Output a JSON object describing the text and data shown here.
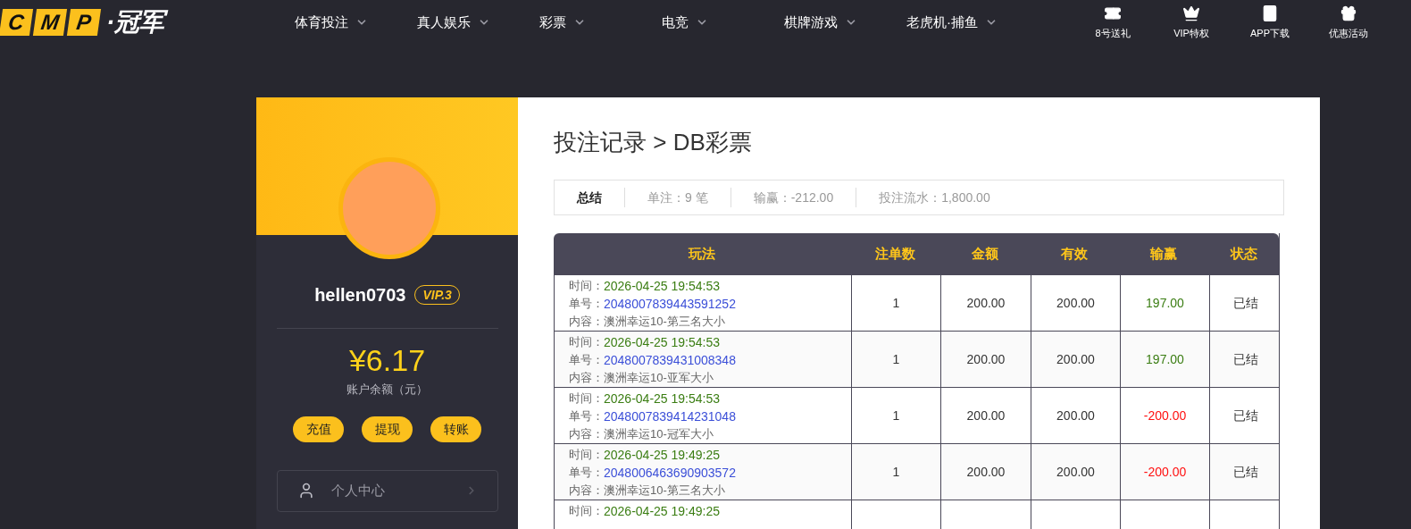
{
  "header": {
    "logo_letters": [
      "C",
      "M",
      "P"
    ],
    "logo_text": "·冠军",
    "nav": [
      {
        "label": "体育投注"
      },
      {
        "label": "真人娱乐"
      },
      {
        "label": "彩票"
      },
      {
        "label": "电竞"
      },
      {
        "label": "棋牌游戏"
      },
      {
        "label": "老虎机·捕鱼"
      }
    ],
    "shortcuts": [
      {
        "kind": "ticket",
        "label": "8号送礼"
      },
      {
        "kind": "crown",
        "label": "VIP特权"
      },
      {
        "kind": "phone",
        "label": "APP下载"
      },
      {
        "kind": "gift",
        "label": "优惠活动"
      }
    ]
  },
  "profile": {
    "username": "hellen0703",
    "vip": "VIP.3",
    "balance": "¥6.17",
    "balance_label": "账户余额（元）",
    "actions": [
      "充值",
      "提现",
      "转账"
    ],
    "menu": [
      {
        "label": "个人中心"
      }
    ]
  },
  "page": {
    "title": "投注记录 > DB彩票",
    "summary": [
      {
        "text": "总结",
        "bold": true
      },
      {
        "text": "单注：9 笔",
        "bold": false
      },
      {
        "text": "输赢：-212.00",
        "bold": false
      },
      {
        "text": "投注流水：1,800.00",
        "bold": false
      }
    ],
    "table": {
      "columns": [
        "玩法",
        "注单数",
        "金额",
        "有效",
        "输赢",
        "状态"
      ],
      "rows": [
        {
          "time_label": "时间：",
          "time": "2026-04-25 19:54:53",
          "order_label": "单号：",
          "order": "2048007839443591252",
          "content": "内容：澳洲幸运10-第三名大小",
          "count": "1",
          "amount": "200.00",
          "valid": "200.00",
          "result": "197.00",
          "color": "#3a7d12",
          "status": "已结"
        },
        {
          "time_label": "时间：",
          "time": "2026-04-25 19:54:53",
          "order_label": "单号：",
          "order": "2048007839431008348",
          "content": "内容：澳洲幸运10-亚军大小",
          "count": "1",
          "amount": "200.00",
          "valid": "200.00",
          "result": "197.00",
          "color": "#3a7d12",
          "status": "已结"
        },
        {
          "time_label": "时间：",
          "time": "2026-04-25 19:54:53",
          "order_label": "单号：",
          "order": "2048007839414231048",
          "content": "内容：澳洲幸运10-冠军大小",
          "count": "1",
          "amount": "200.00",
          "valid": "200.00",
          "result": "-200.00",
          "color": "#ff1010",
          "status": "已结"
        },
        {
          "time_label": "时间：",
          "time": "2026-04-25 19:49:25",
          "order_label": "单号：",
          "order": "2048006463690903572",
          "content": "内容：澳洲幸运10-第三名大小",
          "count": "1",
          "amount": "200.00",
          "valid": "200.00",
          "result": "-200.00",
          "color": "#ff1010",
          "status": "已结"
        },
        {
          "time_label": "时间：",
          "time": "2026-04-25 19:49:25"
        }
      ]
    }
  }
}
